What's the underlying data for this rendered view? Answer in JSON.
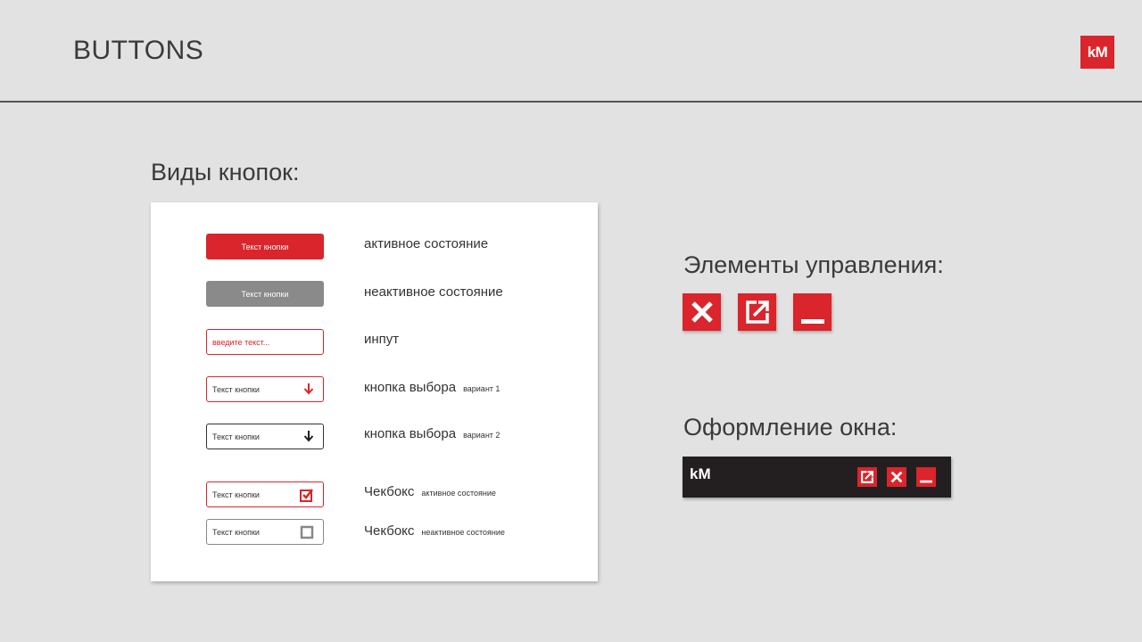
{
  "header": {
    "title": "BUTTONS",
    "logo": "kM"
  },
  "sections": {
    "button_types": "Виды кнопок:",
    "controls": "Элементы управления:",
    "window": "Оформление окна:"
  },
  "demos": {
    "active_button": "Текст кнопки",
    "inactive_button": "Текст кнопки",
    "input_placeholder": "введите текст...",
    "select_v1": "Текст кнопки",
    "select_v2": "Текст кнопки",
    "checkbox_active": "Текст кнопки",
    "checkbox_inactive": "Текст кнопки"
  },
  "descriptions": {
    "active": "активное состояние",
    "inactive": "неактивное состояние",
    "input": "инпут",
    "select_v1": "кнопка выбора",
    "select_v1_note": "вариант 1",
    "select_v2": "кнопка выбора",
    "select_v2_note": "вариант 2",
    "checkbox_active": "Чекбокс",
    "checkbox_active_note": "активное состояние",
    "checkbox_inactive": "Чекбокс",
    "checkbox_inactive_note": "неактивное состояние"
  },
  "window_bar": {
    "logo": "kM"
  },
  "icons": {
    "close": "close-icon",
    "open_external": "external-link-icon",
    "minimize": "minimize-icon",
    "arrow": "arrow-down-icon",
    "checkbox_checked": "checkbox-checked-icon",
    "checkbox_empty": "checkbox-empty-icon"
  },
  "colors": {
    "accent": "#d9252b",
    "background": "#e2e2e2",
    "inactive": "#8a8a8a",
    "window": "#231f20"
  }
}
